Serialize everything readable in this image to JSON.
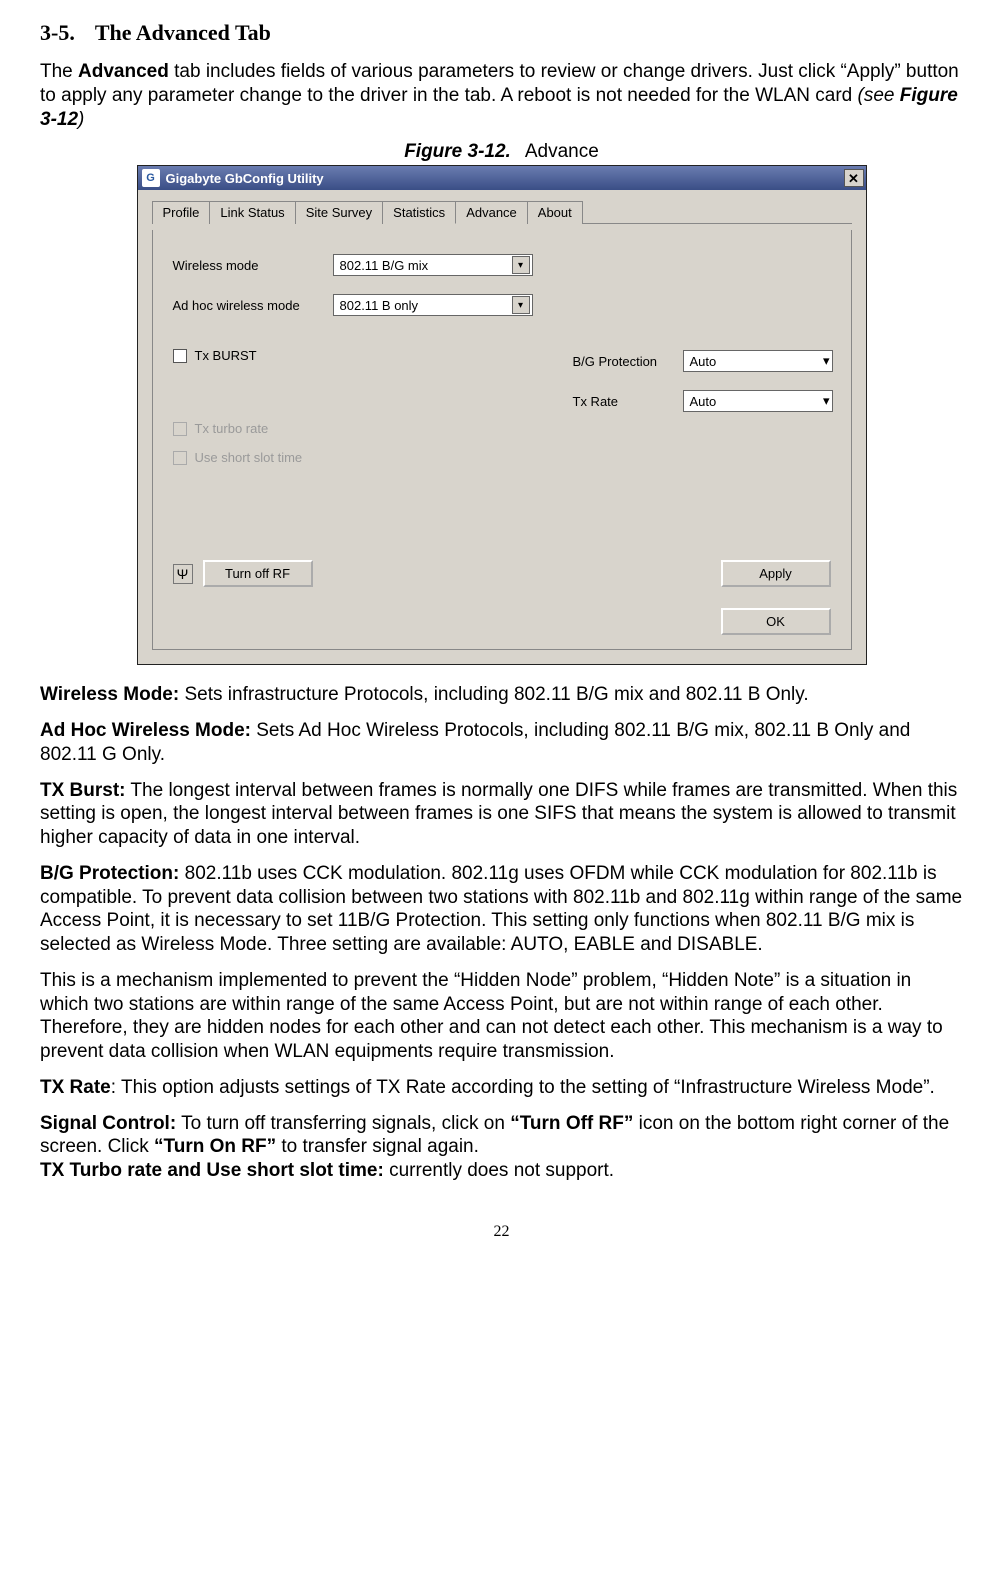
{
  "section": {
    "number": "3-5.",
    "title": "The Advanced Tab"
  },
  "intro": {
    "line1_a": "The ",
    "line1_b": "Advanced",
    "line1_c": " tab includes fields of various parameters to review or change drivers. Just click “Apply” button to apply any parameter change to the driver in the tab. A reboot is not needed for the WLAN card ",
    "see_a": "(see ",
    "see_b": "Figure 3-12",
    "see_c": ")"
  },
  "figure": {
    "label": "Figure 3-12.",
    "caption": "Advance"
  },
  "window": {
    "title": "Gigabyte GbConfig Utility",
    "logo": "G",
    "tabs": [
      "Profile",
      "Link Status",
      "Site Survey",
      "Statistics",
      "Advance",
      "About"
    ],
    "active_tab_index": 4,
    "wireless_mode_label": "Wireless mode",
    "wireless_mode_value": "802.11 B/G mix",
    "adhoc_label": "Ad hoc wireless mode",
    "adhoc_value": "802.11 B only",
    "tx_burst_label": "Tx BURST",
    "tx_turbo_label": "Tx turbo rate",
    "short_slot_label": "Use short slot time",
    "bg_label": "B/G Protection",
    "bg_value": "Auto",
    "txrate_label": "Tx Rate",
    "txrate_value": "Auto",
    "btn_rf": "Turn off RF",
    "btn_apply": "Apply",
    "btn_ok": "OK",
    "close_glyph": "✕",
    "arrow_glyph": "▾",
    "rf_glyph": "Ψ"
  },
  "defs": {
    "wm_l": "Wireless Mode:",
    "wm_t": " Sets infrastructure Protocols, including 802.11 B/G mix and 802.11 B Only.",
    "ah_l": "Ad Hoc Wireless Mode:",
    "ah_t": " Sets Ad Hoc Wireless Protocols, including 802.11 B/G mix, 802.11 B Only and 802.11 G Only.",
    "txb_l": "TX Burst:",
    "txb_t": " The longest interval between frames is normally one DIFS while frames are transmitted. When this setting is open, the longest interval between frames is one SIFS that means the system is allowed to transmit higher capacity of data in one interval.",
    "bg_l": "B/G Protection:",
    "bg_t": " 802.11b uses CCK modulation. 802.11g uses OFDM while CCK modulation for 802.11b is compatible. To prevent data collision between two stations with 802.11b and 802.11g within range of the same Access Point, it is necessary to set 11B/G Protection. This setting only functions when 802.11 B/G mix is selected as Wireless Mode. Three setting are available: AUTO, EABLE and DISABLE.",
    "hidden": "This is a mechanism implemented to prevent the “Hidden Node” problem, “Hidden Note” is a situation in which two stations are within range of the same Access Point, but are not within range of each other. Therefore, they are hidden nodes for each other and can not detect each other. This mechanism is a way to prevent data collision when WLAN equipments require transmission.",
    "txr_l": "TX Rate",
    "txr_t": ": This option adjusts settings of TX Rate according to the setting of “Infrastructure Wireless Mode”.",
    "sc_l": "Signal Control:",
    "sc_t1": " To turn off transferring signals, click on ",
    "sc_b1": "“Turn Off RF”",
    "sc_t2": " icon on the bottom right corner of the screen. Click ",
    "sc_b2": "“Turn On RF”",
    "sc_t3": " to transfer signal again.",
    "tt_l": "TX Turbo rate and Use short slot time:",
    "tt_t": " currently does not support."
  },
  "pagenum": "22"
}
